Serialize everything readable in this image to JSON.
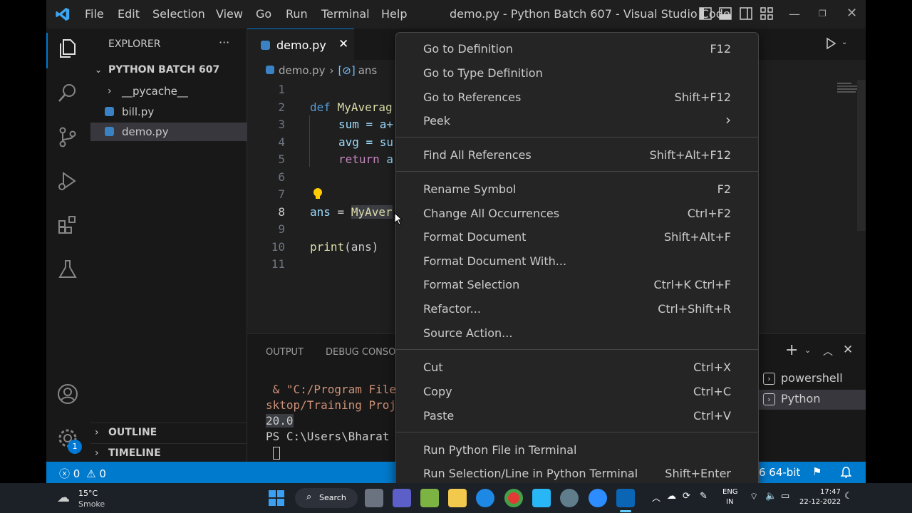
{
  "titlebar": {
    "menus": [
      "File",
      "Edit",
      "Selection",
      "View",
      "Go",
      "Run",
      "Terminal",
      "Help"
    ],
    "title": "demo.py - Python Batch 607 - Visual Studio Code"
  },
  "activity": {
    "settings_badge": "1"
  },
  "sidebar": {
    "header": "EXPLORER",
    "more": "···",
    "folder": "PYTHON BATCH 607",
    "items": [
      "__pycache__",
      "bill.py",
      "demo.py"
    ],
    "outline": "OUTLINE",
    "timeline": "TIMELINE"
  },
  "editor": {
    "tab_label": "demo.py",
    "breadcrumb_file": "demo.py",
    "breadcrumb_symbol": "ans",
    "line_numbers": [
      "1",
      "2",
      "3",
      "4",
      "5",
      "6",
      "7",
      "8",
      "9",
      "10",
      "11"
    ],
    "code": {
      "l2_kw": "def",
      "l2_fn": "MyAverag",
      "l3": "sum = a+",
      "l4": "avg = su",
      "l5_kw": "return",
      "l5_rest": " a",
      "l8_var": "ans",
      "l8_eq": " = ",
      "l8_fn": "MyAver",
      "l10_fn": "print",
      "l10_rest": "(ans)"
    }
  },
  "panel": {
    "tabs": [
      "OUTPUT",
      "DEBUG CONSO"
    ],
    "terminal_lines": [
      " & \"C:/Program File",
      "sktop/Training Proj",
      "20.0",
      "PS C:\\Users\\Bharat "
    ],
    "terminals": [
      "powershell",
      "Python"
    ]
  },
  "statusbar": {
    "errors": "0",
    "warnings": "0",
    "interpreter": "6 64-bit"
  },
  "context_menu": {
    "groups": [
      [
        {
          "label": "Go to Definition",
          "key": "F12"
        },
        {
          "label": "Go to Type Definition",
          "key": ""
        },
        {
          "label": "Go to References",
          "key": "Shift+F12"
        },
        {
          "label": "Peek",
          "key": "›"
        }
      ],
      [
        {
          "label": "Find All References",
          "key": "Shift+Alt+F12"
        }
      ],
      [
        {
          "label": "Rename Symbol",
          "key": "F2"
        },
        {
          "label": "Change All Occurrences",
          "key": "Ctrl+F2"
        },
        {
          "label": "Format Document",
          "key": "Shift+Alt+F"
        },
        {
          "label": "Format Document With...",
          "key": ""
        },
        {
          "label": "Format Selection",
          "key": "Ctrl+K Ctrl+F"
        },
        {
          "label": "Refactor...",
          "key": "Ctrl+Shift+R"
        },
        {
          "label": "Source Action...",
          "key": ""
        }
      ],
      [
        {
          "label": "Cut",
          "key": "Ctrl+X"
        },
        {
          "label": "Copy",
          "key": "Ctrl+C"
        },
        {
          "label": "Paste",
          "key": "Ctrl+V"
        }
      ],
      [
        {
          "label": "Run Python File in Terminal",
          "key": ""
        },
        {
          "label": "Run Selection/Line in Python Terminal",
          "key": "Shift+Enter"
        }
      ]
    ]
  },
  "taskbar": {
    "weather_temp": "15°C",
    "weather_desc": "Smoke",
    "search": "Search",
    "lang1": "ENG",
    "lang2": "IN",
    "time": "17:47",
    "date": "22-12-2022"
  },
  "colors": {
    "accent": "#007acc",
    "keyword": "#569cd6",
    "function": "#dcdcaa",
    "control": "#c586c0",
    "string": "#ce9178"
  }
}
